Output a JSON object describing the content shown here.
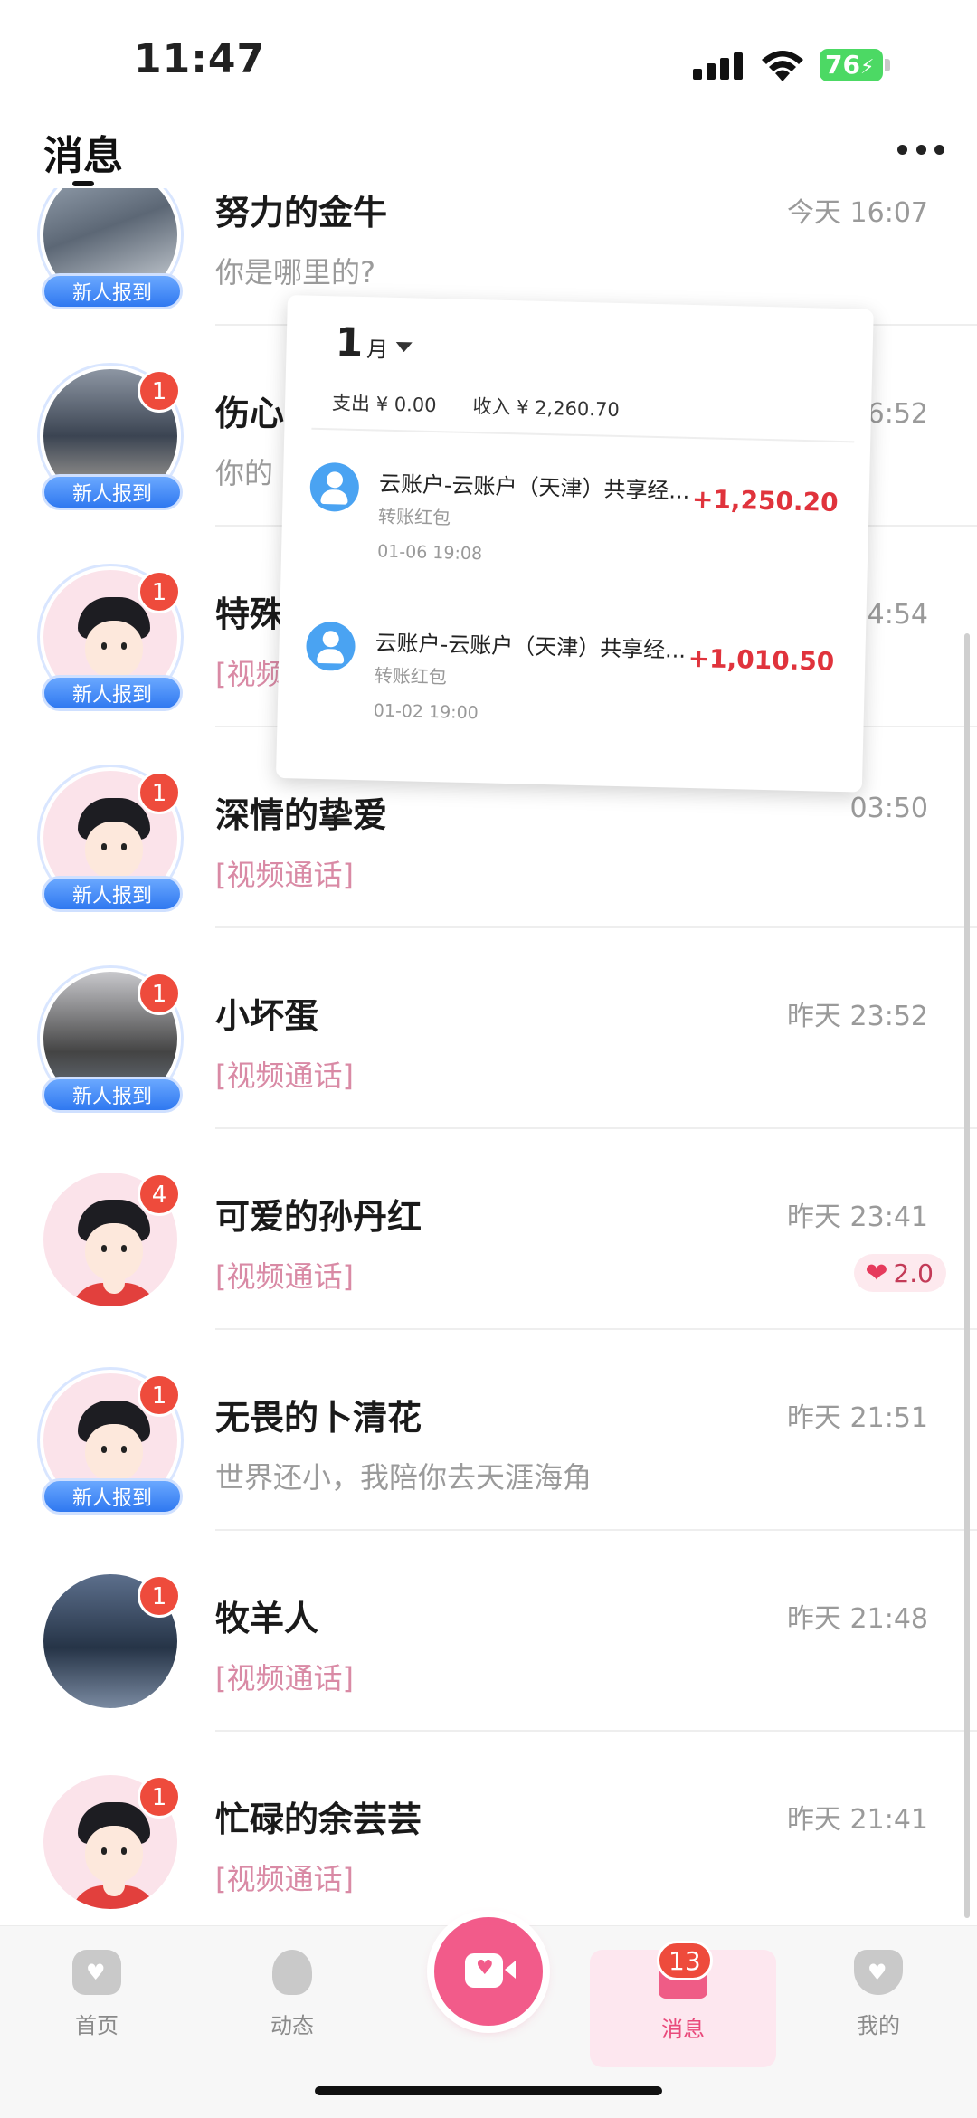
{
  "status_bar": {
    "time": "11:47",
    "battery": "76"
  },
  "header": {
    "title": "消息"
  },
  "messages": [
    {
      "name": "努力的金牛",
      "time": "今天 16:07",
      "preview": "你是哪里的?",
      "badge": "",
      "new_tag": "新人报到"
    },
    {
      "name": "伤心",
      "time": "今天 16:52",
      "preview": "你的",
      "badge": "1",
      "new_tag": "新人报到"
    },
    {
      "name": "特殊",
      "time": "今天 14:54",
      "preview": "[视频",
      "badge": "1",
      "new_tag": "新人报到"
    },
    {
      "name": "深情的挚爱",
      "time": "03:50",
      "preview": "[视频通话]",
      "badge": "1",
      "new_tag": "新人报到"
    },
    {
      "name": "小坏蛋",
      "time": "昨天 23:52",
      "preview": "[视频通话]",
      "badge": "1",
      "new_tag": "新人报到"
    },
    {
      "name": "可爱的孙丹红",
      "time": "昨天 23:41",
      "preview": "[视频通话]",
      "badge": "4",
      "gift": "2.0"
    },
    {
      "name": "无畏的卜清花",
      "time": "昨天 21:51",
      "preview": "世界还小，我陪你去天涯海角",
      "badge": "1",
      "new_tag": "新人报到"
    },
    {
      "name": "牧羊人",
      "time": "昨天 21:48",
      "preview": "[视频通话]",
      "badge": "1"
    },
    {
      "name": "忙碌的余芸芸",
      "time": "昨天 21:41",
      "preview": "[视频通话]",
      "badge": "1"
    }
  ],
  "transfer_card": {
    "month": "1",
    "month_unit": "月",
    "expense": "支出 ¥ 0.00",
    "income": "收入 ¥ 2,260.70",
    "transactions": [
      {
        "title": "云账户-云账户（天津）共享经...",
        "subtitle": "转账红包",
        "date": "01-06 19:08",
        "amount": "+1,250.20"
      },
      {
        "title": "云账户-云账户（天津）共享经...",
        "subtitle": "转账红包",
        "date": "01-02 19:00",
        "amount": "+1,010.50"
      }
    ]
  },
  "nav": {
    "items": [
      {
        "label": "首页"
      },
      {
        "label": "动态"
      },
      {
        "label": "消息",
        "badge": "13"
      },
      {
        "label": "我的"
      }
    ]
  },
  "colors": {
    "accent": "#f25b8a",
    "badge": "#ee4b3c",
    "amount": "#e0333c",
    "call_preview": "#d98aa5"
  }
}
